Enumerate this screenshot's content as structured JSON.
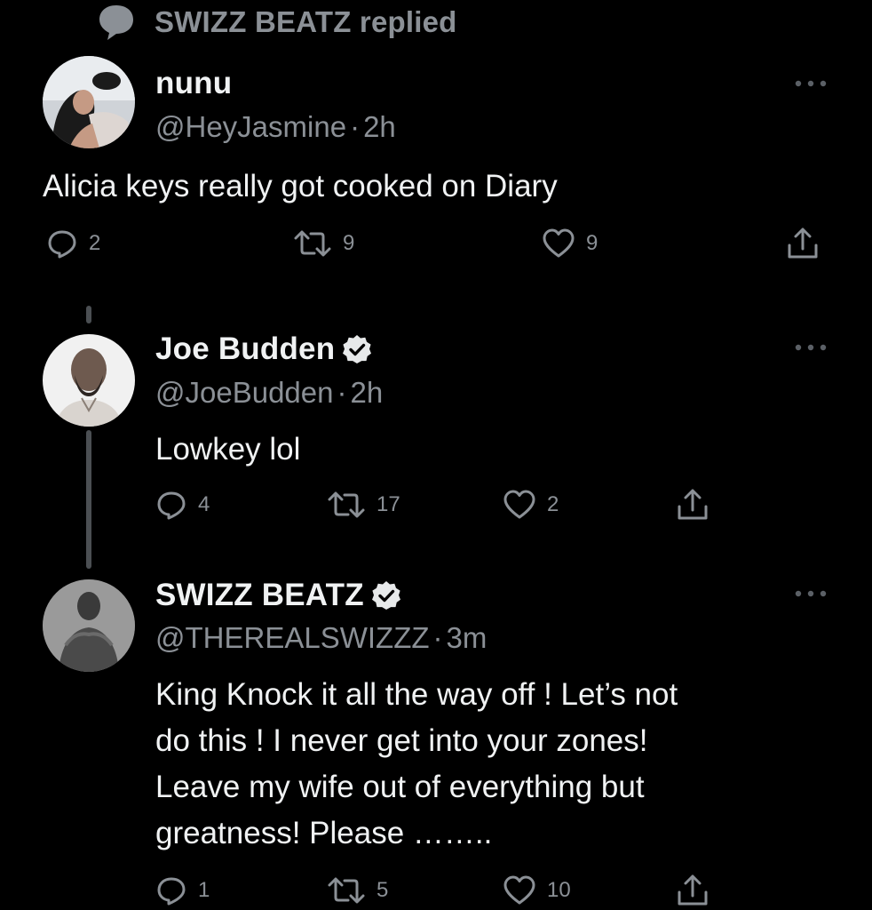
{
  "replied": {
    "text": "SWIZZ BEATZ replied"
  },
  "tweets": [
    {
      "name": "nunu",
      "handle": "@HeyJasmine",
      "time": "2h",
      "text": "Alicia keys really got cooked on Diary",
      "replies": "2",
      "retweets": "9",
      "likes": "9",
      "verified": false
    },
    {
      "name": "Joe Budden",
      "handle": "@JoeBudden",
      "time": "2h",
      "text": "Lowkey lol",
      "replies": "4",
      "retweets": "17",
      "likes": "2",
      "verified": true
    },
    {
      "name": "SWIZZ BEATZ",
      "handle": "@THEREALSWIZZZ",
      "time": "3m",
      "text": "King Knock it all the way off ! Let’s not\ndo this ! I never get into your zones!\nLeave my wife out of everything but\ngreatness! Please ……..",
      "replies": "1",
      "retweets": "5",
      "likes": "10",
      "verified": true
    }
  ],
  "separator": "·",
  "colors": {
    "background": "#000000",
    "primary_text": "#f0f2f3",
    "secondary_text": "#8b9096",
    "verified_badge": "#e7e9ea",
    "thread_line": "#4b4f53"
  },
  "icons": {
    "replied": "speech-bubble-icon",
    "reply": "reply-icon",
    "retweet": "retweet-icon",
    "like": "heart-icon",
    "share": "share-icon",
    "more": "more-icon",
    "verified": "verified-badge-icon"
  }
}
